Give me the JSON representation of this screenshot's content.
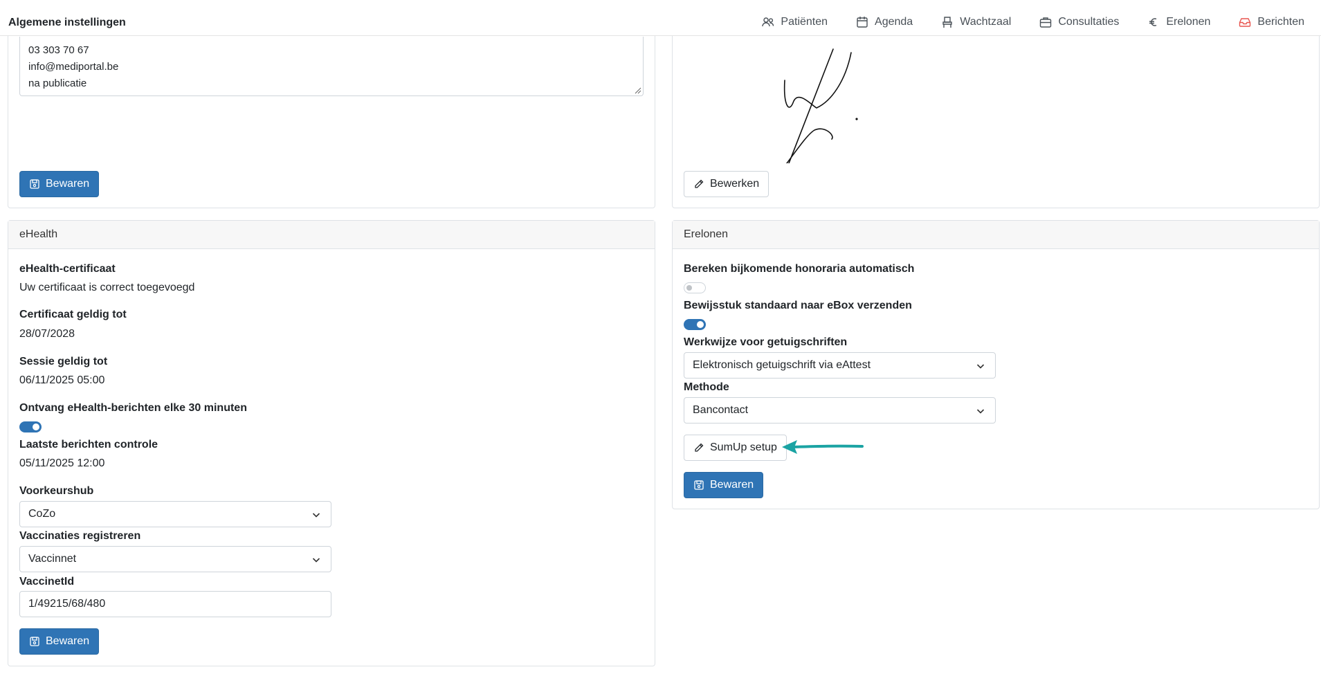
{
  "header": {
    "title": "Algemene instellingen",
    "nav": [
      {
        "label": "Patiënten",
        "icon": "users-icon"
      },
      {
        "label": "Agenda",
        "icon": "calendar-icon"
      },
      {
        "label": "Wachtzaal",
        "icon": "chair-icon"
      },
      {
        "label": "Consultaties",
        "icon": "briefcase-icon"
      },
      {
        "label": "Erelonen",
        "icon": "euro-icon"
      },
      {
        "label": "Berichten",
        "icon": "inbox-icon"
      }
    ]
  },
  "contact_card": {
    "lines": [
      "03 303 70 67",
      "info@mediportal.be",
      "na publicatie"
    ],
    "save_label": "Bewaren"
  },
  "signature_card": {
    "edit_label": "Bewerken"
  },
  "ehealth": {
    "header": "eHealth",
    "certificate_label": "eHealth-certificaat",
    "certificate_value": "Uw certificaat is correct toegevoegd",
    "cert_valid_label": "Certificaat geldig tot",
    "cert_valid_value": "28/07/2028",
    "session_label": "Sessie geldig tot",
    "session_value": "06/11/2025 05:00",
    "receive_label": "Ontvang eHealth-berichten elke 30 minuten",
    "receive_enabled": true,
    "last_check_label": "Laatste berichten controle",
    "last_check_value": "05/11/2025 12:00",
    "hub_label": "Voorkeurshub",
    "hub_value": "CoZo",
    "vacc_label": "Vaccinaties registreren",
    "vacc_value": "Vaccinnet",
    "vaccinetid_label": "VaccinetId",
    "vaccinetid_value": "1/49215/68/480",
    "save_label": "Bewaren"
  },
  "erelonen": {
    "header": "Erelonen",
    "auto_fee_label": "Bereken bijkomende honoraria automatisch",
    "auto_fee_enabled": false,
    "ebox_label": "Bewijsstuk standaard naar eBox verzenden",
    "ebox_enabled": true,
    "method_certificates_label": "Werkwijze voor getuigschriften",
    "method_certificates_value": "Elektronisch getuigschrift via eAttest",
    "method_label": "Methode",
    "method_value": "Bancontact",
    "sumup_label": "SumUp setup",
    "save_label": "Bewaren"
  },
  "colors": {
    "primary": "#2f74b5",
    "arrow": "#1aa3a3",
    "alert": "#e8544e"
  }
}
